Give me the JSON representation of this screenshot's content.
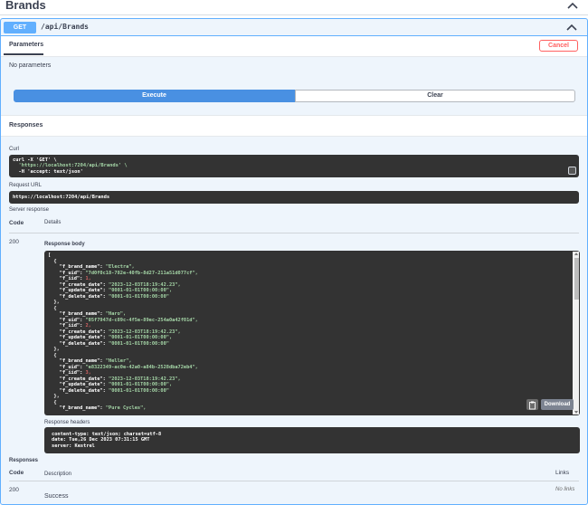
{
  "section": {
    "title": "Brands"
  },
  "operation": {
    "method": "GET",
    "path": "/api/Brands"
  },
  "tabs": {
    "parameters_label": "Parameters",
    "cancel_label": "Cancel"
  },
  "parameters": {
    "empty_text": "No parameters"
  },
  "actions": {
    "execute_label": "Execute",
    "clear_label": "Clear"
  },
  "responses_section": {
    "title": "Responses"
  },
  "curl": {
    "label": "Curl",
    "lines": [
      {
        "prefix": "curl -X 'GET' \\",
        "str": ""
      },
      {
        "prefix": "  ",
        "str": "'https://localhost:7204/api/Brands' \\"
      },
      {
        "prefix": "  -H 'accept: text/json'",
        "str": ""
      }
    ]
  },
  "request_url": {
    "label": "Request URL",
    "value": "https://localhost:7204/api/Brands"
  },
  "server_response": {
    "label": "Server response",
    "col_code": "Code",
    "col_details": "Details",
    "code": "200",
    "body_label": "Response body",
    "body_lines": [
      "[",
      "  {",
      "    \"f_brand_name\": \"Electra\",",
      "    \"f_uid\": \"7d0f0c18-782e-40fb-8d27-211a51d077cf\",",
      "    \"f_iid\": 1,",
      "    \"f_create_date\": \"2023-12-03T18:19:42.23\",",
      "    \"f_update_date\": \"0001-01-01T00:00:00\",",
      "    \"f_delete_date\": \"0001-01-01T00:00:00\"",
      "  },",
      "  {",
      "    \"f_brand_name\": \"Haro\",",
      "    \"f_uid\": \"05f7947d-c89c-4f5e-89ec-254a0a42f01d\",",
      "    \"f_iid\": 2,",
      "    \"f_create_date\": \"2023-12-03T18:19:42.23\",",
      "    \"f_update_date\": \"0001-01-01T00:00:00\",",
      "    \"f_delete_date\": \"0001-01-01T00:00:00\"",
      "  },",
      "  {",
      "    \"f_brand_name\": \"Heller\",",
      "    \"f_uid\": \"e8322349-ac0e-42a0-a84b-2528dba72eb4\",",
      "    \"f_iid\": 3,",
      "    \"f_create_date\": \"2023-12-03T18:19:42.23\",",
      "    \"f_update_date\": \"0001-01-01T00:00:00\",",
      "    \"f_delete_date\": \"0001-01-01T00:00:00\"",
      "  },",
      "  {",
      "    \"f_brand_name\": \"Pure Cycles\","
    ],
    "download_label": "Download",
    "headers_label": "Response headers",
    "headers_lines": [
      "content-type: text/json; charset=utf-8",
      "date: Tue,26 Dec 2023 07:31:15 GMT",
      "server: Kestrel"
    ]
  },
  "documented_responses": {
    "title": "Responses",
    "col_code": "Code",
    "col_description": "Description",
    "col_links": "Links",
    "rows": [
      {
        "code": "200",
        "description": "Success",
        "links": "No links"
      }
    ]
  },
  "icons": {
    "collapse": "chevron-up-icon",
    "copy": "copy-icon",
    "clipboard": "clipboard-icon"
  },
  "colors": {
    "get_accent": "#61affe",
    "execute": "#4990e2",
    "cancel": "#ff6060",
    "code_bg": "#333333",
    "string": "#a5d6a7",
    "number": "#d36363"
  }
}
